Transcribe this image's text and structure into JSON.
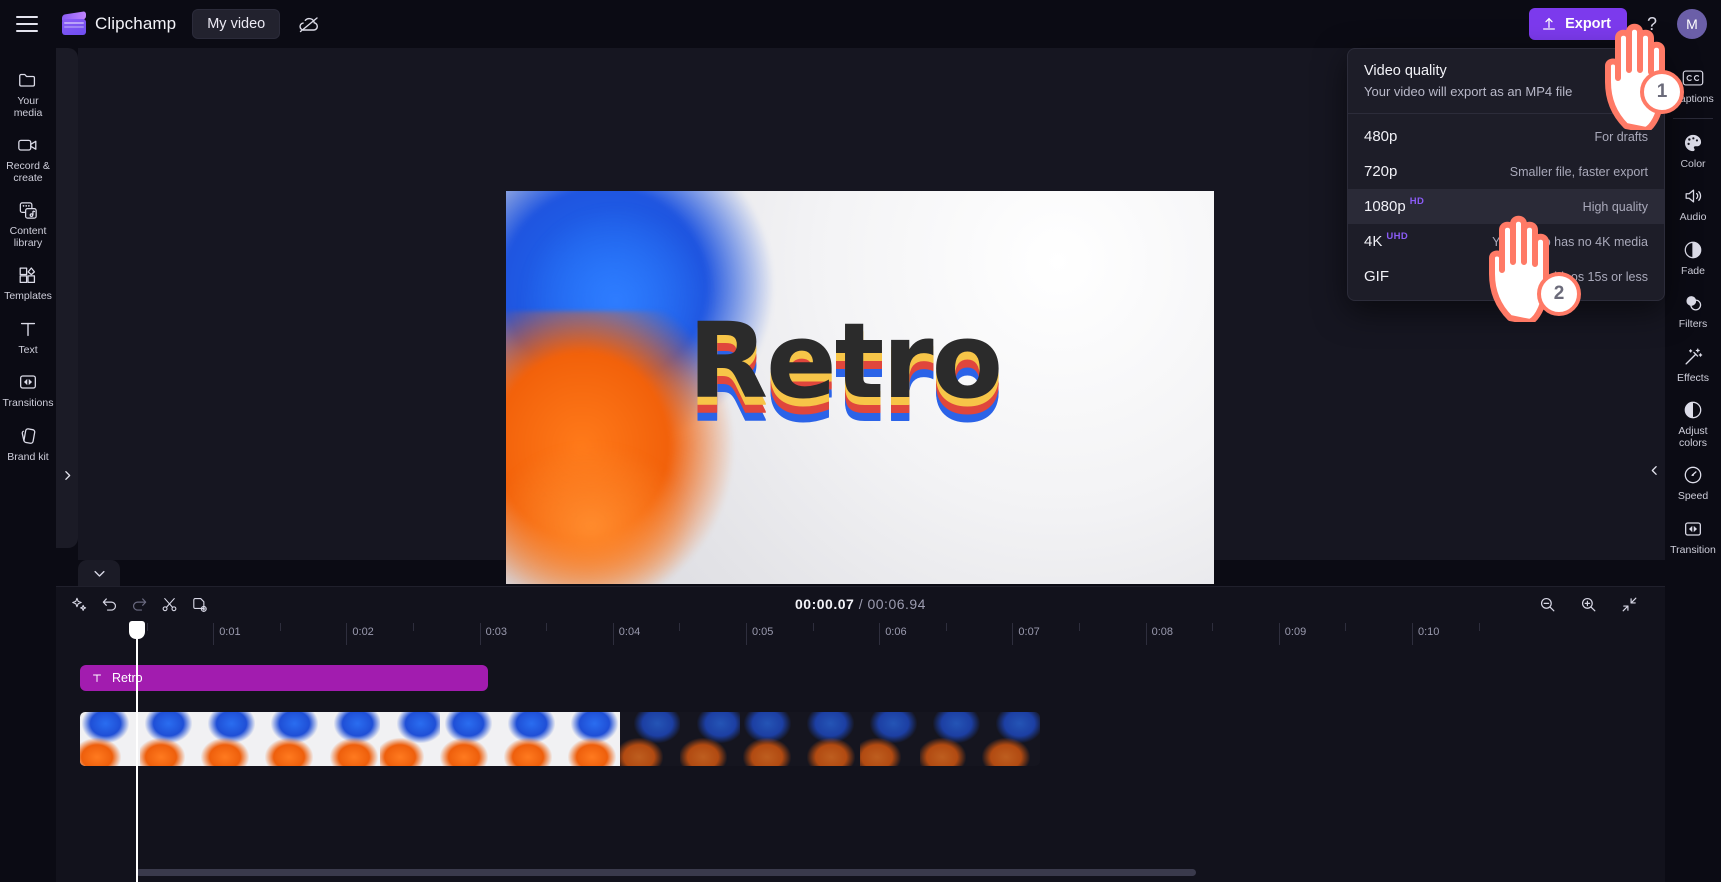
{
  "app": {
    "brand": "Clipchamp",
    "project_title": "My video",
    "menu_icon": "hamburger-icon",
    "cloud_icon": "cloud-off-icon",
    "help_icon": "question-mark-icon",
    "avatar_initial": "M",
    "accent_color": "#7c3aed"
  },
  "topbar": {
    "export_label": "Export",
    "export_icon": "upload-icon"
  },
  "left_rail": {
    "items": [
      {
        "label": "Your media",
        "icon": "folder-icon"
      },
      {
        "label": "Record & create",
        "icon": "video-camera-icon"
      },
      {
        "label": "Content library",
        "icon": "content-library-icon"
      },
      {
        "label": "Templates",
        "icon": "templates-icon"
      },
      {
        "label": "Text",
        "icon": "text-t-icon"
      },
      {
        "label": "Transitions",
        "icon": "transitions-icon"
      },
      {
        "label": "Brand kit",
        "icon": "brand-kit-icon"
      }
    ],
    "expand_icon": "chevron-right-icon"
  },
  "right_rail": {
    "items": [
      {
        "label": "Captions",
        "icon": "cc-icon"
      },
      {
        "label": "Color",
        "icon": "palette-icon"
      },
      {
        "label": "Audio",
        "icon": "speaker-icon"
      },
      {
        "label": "Fade",
        "icon": "fade-icon"
      },
      {
        "label": "Filters",
        "icon": "filters-icon"
      },
      {
        "label": "Effects",
        "icon": "magic-wand-icon"
      },
      {
        "label": "Adjust colors",
        "icon": "adjust-colors-icon"
      },
      {
        "label": "Speed",
        "icon": "speedometer-icon"
      },
      {
        "label": "Transition",
        "icon": "transition-icon"
      }
    ],
    "collapse_icon": "chevron-left-icon"
  },
  "preview": {
    "overlay_text": "Retro",
    "background_description": "blue and orange ink smoke on white"
  },
  "player": {
    "caption_toggle_icon": "captions-off-icon",
    "skip_start_icon": "skip-to-start-icon",
    "back5_icon": "rewind-5-icon",
    "play_icon": "play-icon",
    "forward5_icon": "forward-5-icon",
    "skip_end_icon": "skip-to-end-icon",
    "fullscreen_icon": "fullscreen-icon"
  },
  "timeline": {
    "collapse_icon": "chevron-down-icon",
    "tools": [
      {
        "name": "magic-sparkle-icon",
        "label": "Auto compose"
      },
      {
        "name": "undo-icon",
        "label": "Undo"
      },
      {
        "name": "redo-icon",
        "label": "Redo"
      },
      {
        "name": "scissors-icon",
        "label": "Split"
      },
      {
        "name": "duplicate-icon",
        "label": "Duplicate"
      }
    ],
    "zoom_tools": [
      {
        "name": "zoom-out-icon",
        "label": "Zoom out"
      },
      {
        "name": "zoom-in-icon",
        "label": "Zoom in"
      },
      {
        "name": "fit-to-screen-icon",
        "label": "Fit to screen"
      }
    ],
    "current_time": "00:00.07",
    "total_time": "00:06.94",
    "time_separator": "/",
    "ruler_labels": [
      "0:01",
      "0:02",
      "0:03",
      "0:04",
      "0:05",
      "0:06",
      "0:07",
      "0:08",
      "0:09",
      "0:10"
    ],
    "text_clip": {
      "label": "Retro",
      "icon": "text-t-icon"
    },
    "video_clip": {
      "frames": 16
    }
  },
  "export_menu": {
    "title": "Video quality",
    "subtitle": "Your video will export as an MP4 file",
    "options": [
      {
        "label": "480p",
        "badge": "",
        "desc": "For drafts",
        "selected": false
      },
      {
        "label": "720p",
        "badge": "",
        "desc": "Smaller file, faster export",
        "selected": false
      },
      {
        "label": "1080p",
        "badge": "HD",
        "desc": "High quality",
        "selected": true
      },
      {
        "label": "4K",
        "badge": "UHD",
        "desc": "Your video has no 4K media",
        "selected": false
      },
      {
        "label": "GIF",
        "badge": "",
        "desc": "For videos 15s or less",
        "selected": false
      }
    ]
  },
  "annotations": {
    "steps": [
      {
        "number": "1",
        "target": "export-button"
      },
      {
        "number": "2",
        "target": "export-option-1080p"
      }
    ]
  }
}
